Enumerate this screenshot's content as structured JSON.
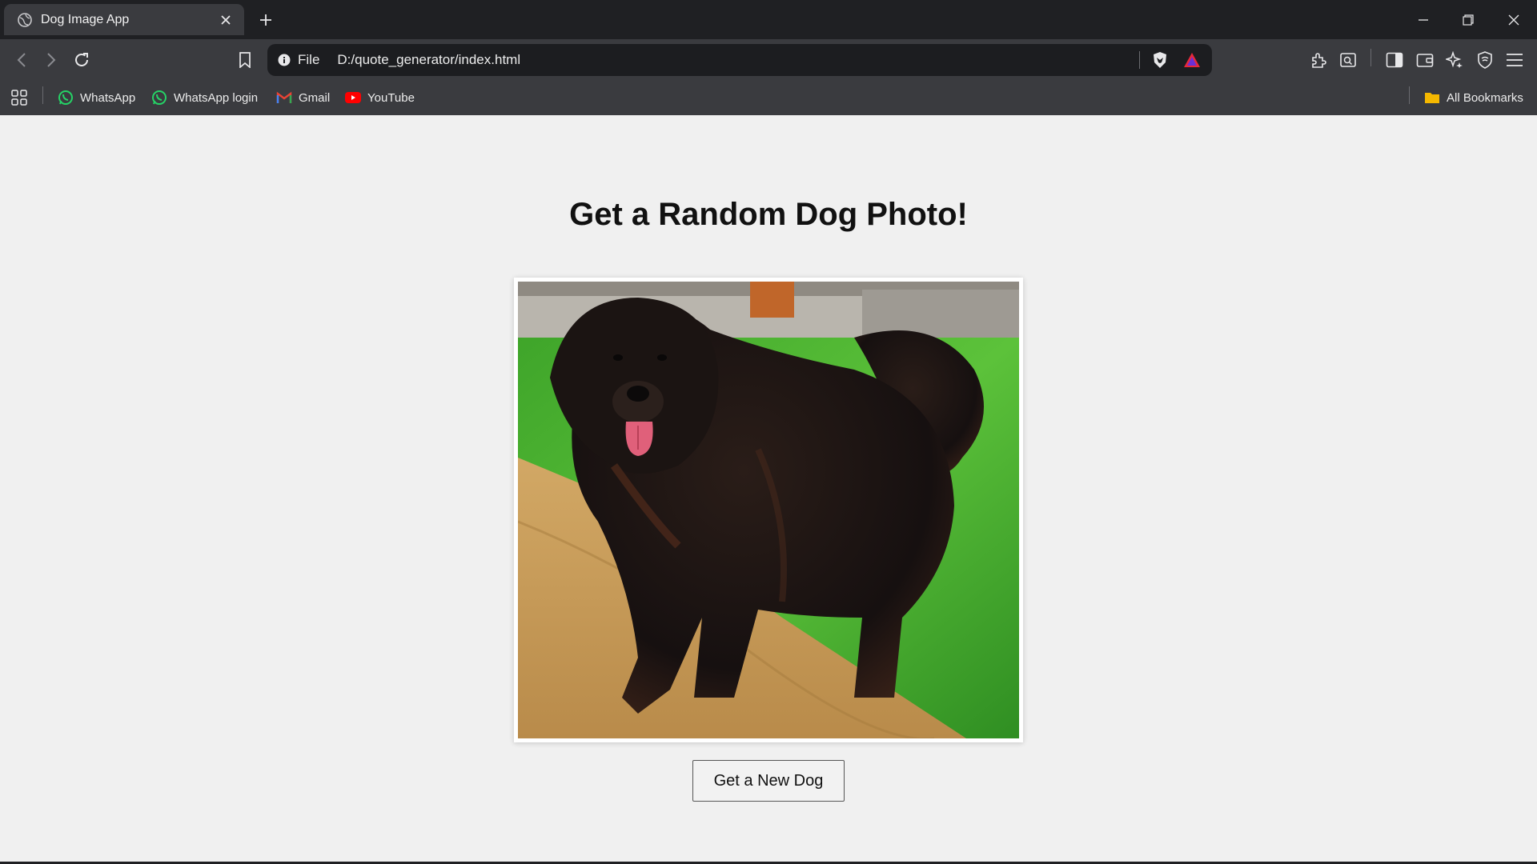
{
  "tab": {
    "title": "Dog Image App"
  },
  "omnibox": {
    "scheme": "File",
    "url": "D:/quote_generator/index.html"
  },
  "bookmarks": {
    "items": [
      {
        "label": "WhatsApp",
        "icon": "whatsapp-icon"
      },
      {
        "label": "WhatsApp login",
        "icon": "whatsapp-icon"
      },
      {
        "label": "Gmail",
        "icon": "gmail-icon"
      },
      {
        "label": "YouTube",
        "icon": "youtube-icon"
      }
    ],
    "all_bookmarks": "All Bookmarks"
  },
  "page": {
    "heading": "Get a Random Dog Photo!",
    "button_label": "Get a New Dog"
  },
  "colors": {
    "chrome_dark": "#1f2023",
    "chrome": "#3a3b3f",
    "page_bg": "#f0f0f0",
    "whatsapp_green": "#25d366",
    "youtube_red": "#ff0000"
  }
}
